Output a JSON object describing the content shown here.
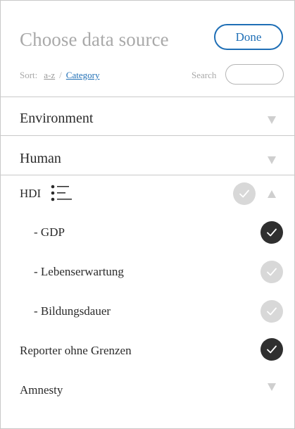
{
  "header": {
    "title": "Choose data source",
    "done_label": "Done"
  },
  "sort": {
    "label": "Sort:",
    "option_az": "a-z",
    "separator": "/",
    "option_category": "Category",
    "active": "Category"
  },
  "search": {
    "label": "Search",
    "value": "",
    "placeholder": ""
  },
  "categories": [
    {
      "label": "Environment",
      "expanded": false
    },
    {
      "label": "Human",
      "expanded": false
    }
  ],
  "items": [
    {
      "label": "HDI",
      "checked": false,
      "expanded": true,
      "has_list_icon": true
    },
    {
      "label": "- GDP",
      "checked": true
    },
    {
      "label": "- Lebenserwartung",
      "checked": false
    },
    {
      "label": "- Bildungsdauer",
      "checked": false
    },
    {
      "label": "Reporter ohne Grenzen",
      "checked": true
    },
    {
      "label": "Amnesty",
      "expanded": false
    }
  ],
  "colors": {
    "accent": "#1f6fb6",
    "check_on": "#2f2f2f",
    "check_off": "#d8d8d8",
    "muted_text": "#a9a9a9"
  },
  "icons": {
    "check": "check-icon",
    "collapse": "triangle-down-icon",
    "expand": "triangle-up-icon",
    "list": "list-icon"
  }
}
